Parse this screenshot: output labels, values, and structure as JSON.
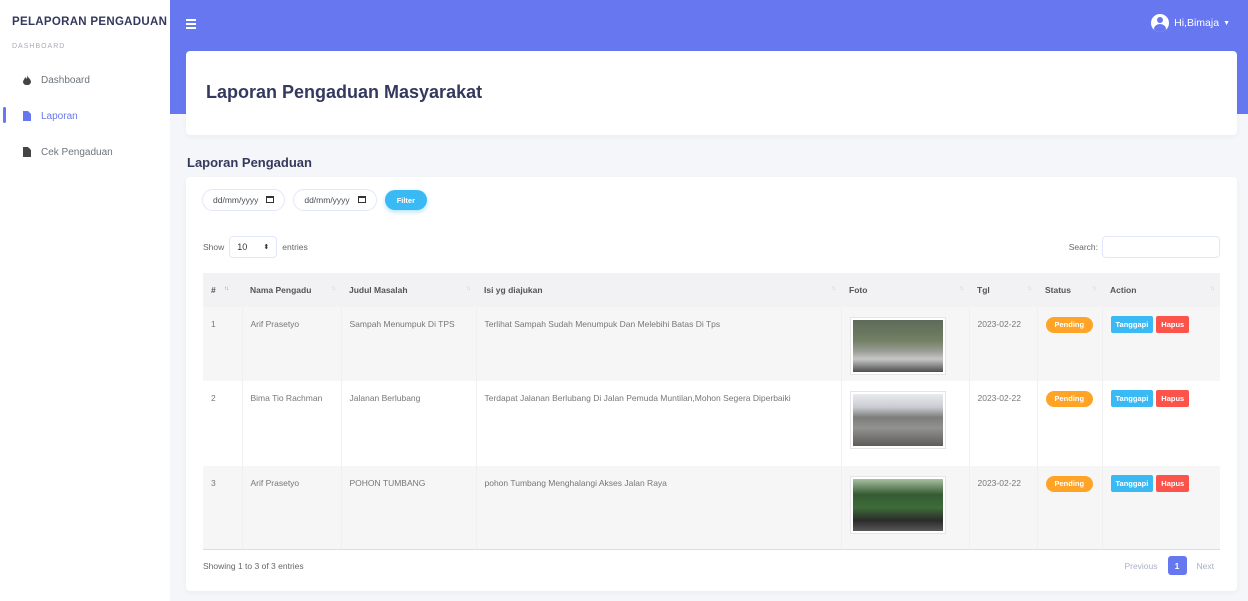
{
  "sidebar": {
    "brand": "PELAPORAN PENGADUAN",
    "section": "DASHBOARD",
    "items": [
      {
        "label": "Dashboard",
        "icon": "fire-icon",
        "active": false
      },
      {
        "label": "Laporan",
        "icon": "file-icon",
        "active": true
      },
      {
        "label": "Cek Pengaduan",
        "icon": "file-icon",
        "active": false
      }
    ]
  },
  "navbar": {
    "user": "Hi,Bimaja",
    "accent": "#6777ef"
  },
  "page": {
    "title": "Laporan Pengaduan Masyarakat",
    "section_title": "Laporan Pengaduan"
  },
  "filters": {
    "date_from_placeholder": "dd/mm/yyyy",
    "date_to_placeholder": "dd/mm/yyyy",
    "filter_label": "Filter"
  },
  "table_controls": {
    "show_label": "Show",
    "entries_value": "10",
    "entries_label": "entries",
    "search_label": "Search:"
  },
  "table": {
    "columns": [
      "#",
      "Nama Pengadu",
      "Judul Masalah",
      "Isi yg diajukan",
      "Foto",
      "Tgl",
      "Status",
      "Action"
    ],
    "rows": [
      {
        "no": "1",
        "nama": "Arif Prasetyo",
        "judul": "Sampah Menumpuk Di TPS",
        "isi": "Terlihat Sampah Sudah Menumpuk Dan Melebihi Batas Di Tps",
        "tgl": "2023-02-22",
        "status": "Pending"
      },
      {
        "no": "2",
        "nama": "Bima Tio Rachman",
        "judul": "Jalanan Berlubang",
        "isi": "Terdapat Jalanan Berlubang Di Jalan Pemuda Muntilan,Mohon Segera Diperbaiki",
        "tgl": "2023-02-22",
        "status": "Pending"
      },
      {
        "no": "3",
        "nama": "Arif Prasetyo",
        "judul": "POHON TUMBANG",
        "isi": "pohon Tumbang Menghalangi Akses Jalan Raya",
        "tgl": "2023-02-22",
        "status": "Pending"
      }
    ],
    "action_tanggapi": "Tanggapi",
    "action_hapus": "Hapus"
  },
  "footer": {
    "info": "Showing 1 to 3 of 3 entries",
    "previous": "Previous",
    "current_page": "1",
    "next": "Next"
  }
}
